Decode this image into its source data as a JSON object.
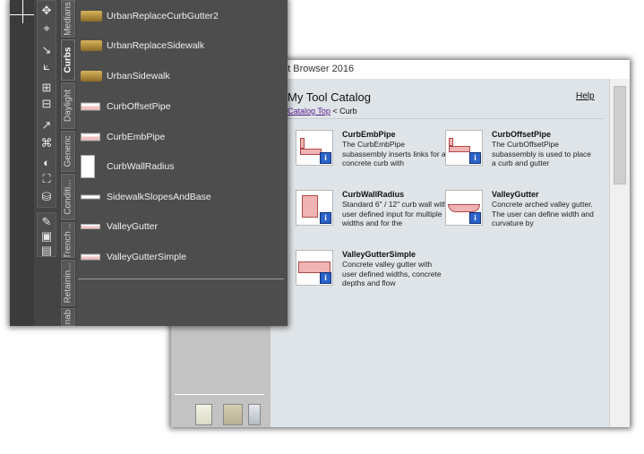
{
  "browser": {
    "window_title_fragment": "nt Browser 2016",
    "catalog_title": "My Tool Catalog",
    "help_label": "Help",
    "breadcrumb": {
      "link": "Catalog Top",
      "separator": " < ",
      "current": "Curb"
    },
    "tools": [
      {
        "name": "CurbEmbPipe",
        "description": "The CurbEmbPipe subassembly inserts links for a concrete curb with"
      },
      {
        "name": "CurbOffsetPipe",
        "description": "The CurbOffsetPipe subassembly is used to place a curb and gutter"
      },
      {
        "name": "CurbWallRadius",
        "description": "Standard 6\" / 12\" curb wall with user defined input for multiple widths and for the"
      },
      {
        "name": "ValleyGutter",
        "description": "Concrete arched valley gutter. The user can define width and curvature by"
      },
      {
        "name": "ValleyGutterSimple",
        "description": "Concrete valley gutter with user defined widths, concrete depths and flow"
      }
    ],
    "info_glyph": "i"
  },
  "palette": {
    "tabs": [
      {
        "label": "Medians",
        "active": false
      },
      {
        "label": "Curbs",
        "active": true
      },
      {
        "label": "Daylight",
        "active": false
      },
      {
        "label": "Generic",
        "active": false
      },
      {
        "label": "Conditi...",
        "active": false
      },
      {
        "label": "Trench ...",
        "active": false
      },
      {
        "label": "Retainin...",
        "active": false
      },
      {
        "label": "nab",
        "active": false
      }
    ],
    "items": [
      {
        "label": "UrbanReplaceCurbGutter2",
        "icon": "gold-curb-icon"
      },
      {
        "label": "UrbanReplaceSidewalk",
        "icon": "gold-sidewalk-icon"
      },
      {
        "label": "UrbanSidewalk",
        "icon": "gold-sidewalk-icon"
      },
      {
        "label": "CurbOffsetPipe",
        "icon": "curb-section-icon"
      },
      {
        "label": "CurbEmbPipe",
        "icon": "curb-section-icon"
      },
      {
        "label": "CurbWallRadius",
        "icon": "curb-wall-icon"
      },
      {
        "label": "SidewalkSlopesAndBase",
        "icon": "sidewalk-section-icon"
      },
      {
        "label": "ValleyGutter",
        "icon": "gutter-section-icon"
      },
      {
        "label": "ValleyGutterSimple",
        "icon": "gutter-section-icon"
      }
    ],
    "toolbar_glyphs": [
      "✥",
      "⌖",
      "↘",
      "⟀",
      "⊞",
      "⊟",
      "↗",
      "⌘",
      "◐",
      "⛶",
      "⛁",
      "✎",
      "▣",
      "▤"
    ]
  }
}
